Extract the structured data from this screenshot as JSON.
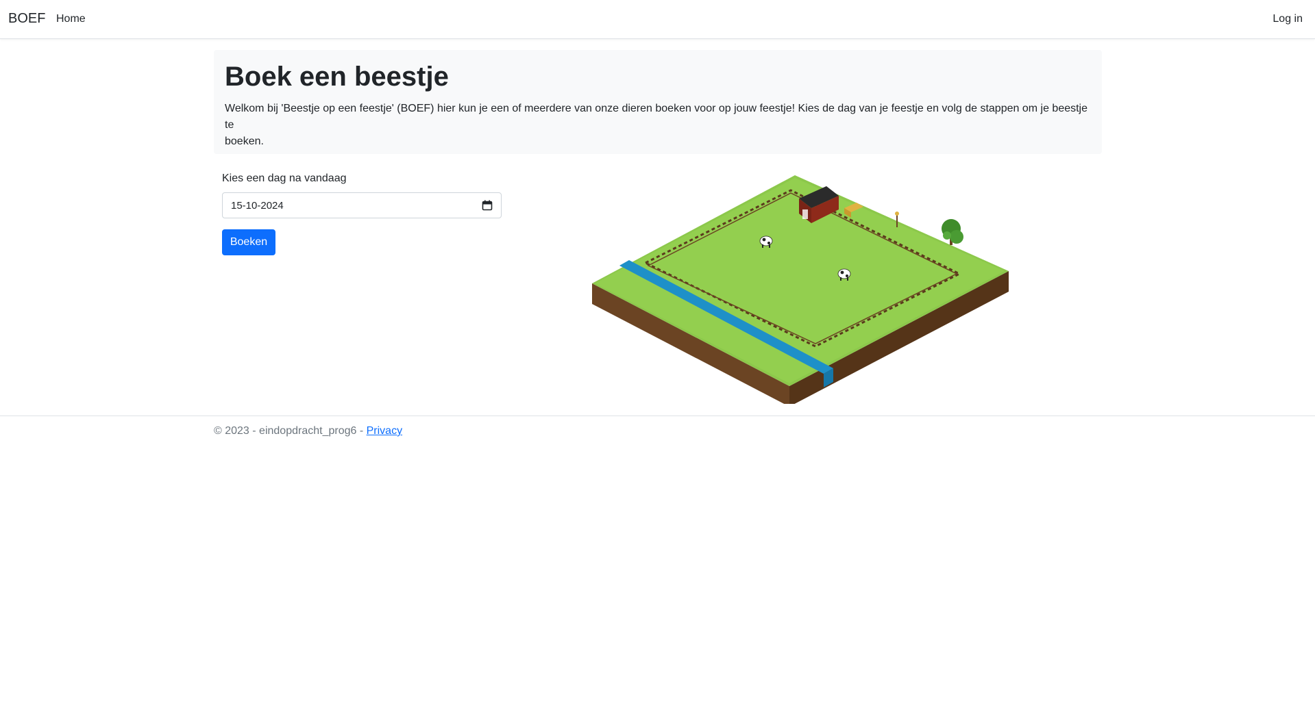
{
  "navbar": {
    "brand": "BOEF",
    "home_label": "Home",
    "login_label": "Log in"
  },
  "hero": {
    "title": "Boek een beestje",
    "intro_line1": "Welkom bij 'Beestje op een feestje' (BOEF) hier kun je een of meerdere van onze dieren boeken voor op jouw feestje! Kies de dag van je feestje en volg de stappen om je beestje te",
    "intro_line2": "boeken."
  },
  "form": {
    "date_label": "Kies een dag na vandaag",
    "date_value": "15-10-2024",
    "submit_label": "Boeken"
  },
  "illustration": {
    "icon": "isometric-farm-illustration"
  },
  "footer": {
    "copyright": "© 2023 - eindopdracht_prog6 - ",
    "privacy_label": "Privacy"
  },
  "colors": {
    "primary": "#0d6efd",
    "hero_bg": "#f8f9fa",
    "muted_text": "#6c757d",
    "grass": "#8cc84b",
    "water": "#1e90c8",
    "dirt": "#6b4423"
  }
}
